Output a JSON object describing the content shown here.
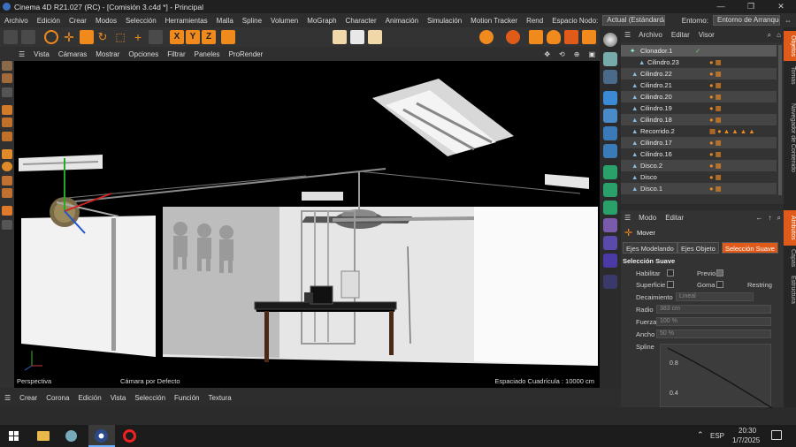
{
  "window": {
    "title": "Cinema 4D R21.027 (RC) - [Comisión 3.c4d *] - Principal"
  },
  "menu": {
    "items": [
      "Archivo",
      "Edición",
      "Crear",
      "Modos",
      "Selección",
      "Herramientas",
      "Malla",
      "Spline",
      "Volumen",
      "MoGraph",
      "Character",
      "Animación",
      "Simulación",
      "Motion Tracker",
      "Rend"
    ],
    "node_space_label": "Espacio Nodo:",
    "node_space_value": "Actual (Estándard/Físico)",
    "env_label": "Entorno:",
    "env_value": "Entorno de Arranque (Usuario)"
  },
  "toolbar": {
    "x": "X",
    "y": "Y",
    "z": "Z"
  },
  "viewport_menu": {
    "items": [
      "Vista",
      "Cámaras",
      "Mostrar",
      "Opciones",
      "Filtrar",
      "Paneles",
      "ProRender"
    ]
  },
  "viewport": {
    "label": "Perspectiva",
    "camera": "Cámara por Defecto",
    "grid": "Espaciado Cuadrícula : 10000 cm"
  },
  "objects_panel": {
    "menu": [
      "Archivo",
      "Editar",
      "Visor"
    ],
    "items": [
      "Clonador.1",
      "Cilindro.23",
      "Cilindro.22",
      "Cilindro.21",
      "Cilindro.20",
      "Cilindro.19",
      "Cilindro.18",
      "Recorrido.2",
      "Cilindro.17",
      "Cilindro.16",
      "Disco.2",
      "Disco",
      "Disco.1"
    ]
  },
  "side_tabs": {
    "top": [
      "Objetos",
      "Tomas",
      "Navegador de Contenido"
    ],
    "bottom": [
      "Atributos",
      "Capas",
      "Estructura"
    ]
  },
  "attributes": {
    "menu": [
      "Modo",
      "Editar"
    ],
    "tool": "Mover",
    "tabs": [
      "Ejes Modelando",
      "Ejes Objeto",
      "Selección Suave"
    ],
    "section": "Selección Suave",
    "habilitar": "Habilitar",
    "previo": "Previo",
    "superficie": "Superficie",
    "goma": "Goma",
    "restringir": "Restring",
    "decaimiento": "Decaimiento",
    "decaimiento_value": "Lineal",
    "radio": "Radio",
    "radio_value": "383 cm",
    "fuerza": "Fuerza",
    "fuerza_value": "100 %",
    "ancho": "Ancho",
    "ancho_value": "50 %",
    "spline": "Spline",
    "g1": "0.8",
    "g2": "0.4"
  },
  "bottom_menu": {
    "items": [
      "Crear",
      "Corona",
      "Edición",
      "Vista",
      "Selección",
      "Función",
      "Textura"
    ]
  },
  "taskbar": {
    "lang": "ESP",
    "time": "20:30",
    "date": "1/7/2025"
  },
  "colors": {
    "accent": "#f08a1d",
    "selected_tab": "#e05a1a"
  }
}
